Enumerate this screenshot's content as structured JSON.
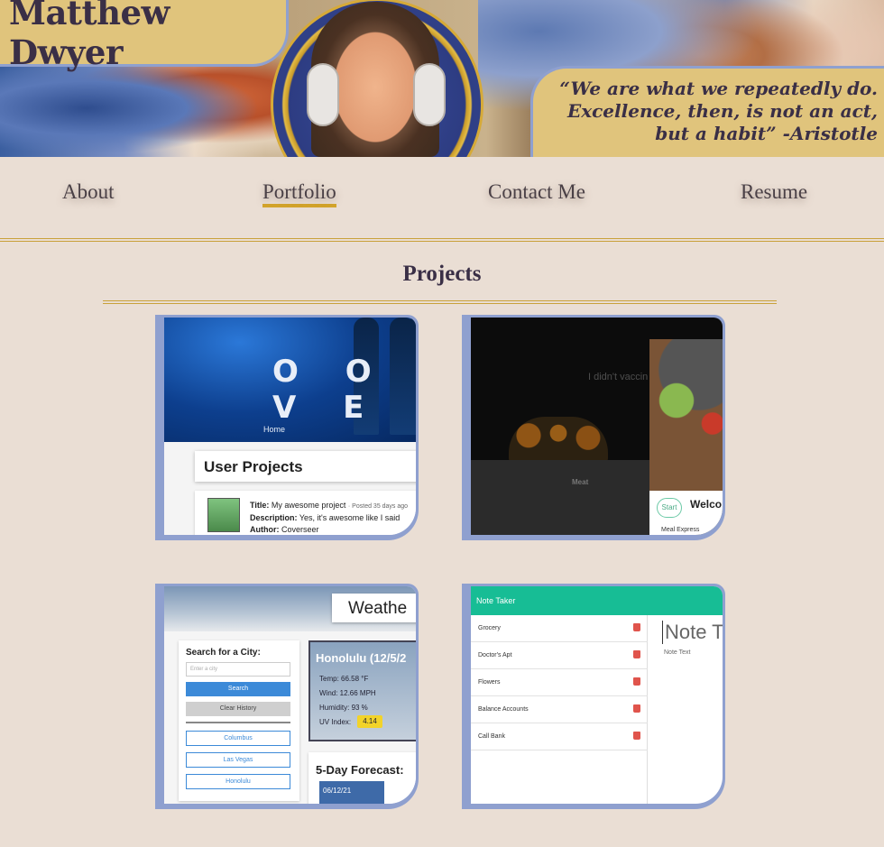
{
  "header": {
    "name": "Matthew Dwyer",
    "quote": "“We are what we repeatedly do. Excellence, then, is not an act, but a habit” -Aristotle"
  },
  "nav": {
    "items": [
      {
        "label": "About",
        "active": false
      },
      {
        "label": "Portfolio",
        "active": true
      },
      {
        "label": "Contact Me",
        "active": false
      },
      {
        "label": "Resume",
        "active": false
      }
    ]
  },
  "projects": {
    "title": "Projects",
    "cards": [
      {
        "banner_logo": "O O V E",
        "banner_nav": "Home",
        "heading": "User Projects",
        "title_label": "Title:",
        "title_value": "My awesome project",
        "posted": "· Posted 35 days ago",
        "desc_label": "Description:",
        "desc_value": "Yes, it's awesome like I said",
        "author_label": "Author:",
        "author_value": "Coverseer"
      },
      {
        "quote": "I didn't vaccin",
        "menu_item": "Meat",
        "start_label": "Start",
        "welcome": "Welco",
        "footer": "Meal Express"
      },
      {
        "title": "Weathe",
        "search_label": "Search for a City:",
        "search_placeholder": "Enter a city",
        "search_button": "Search",
        "clear_button": "Clear History",
        "history": [
          "Columbus",
          "Las Vegas",
          "Honolulu"
        ],
        "current_city": "Honolulu (12/5/2",
        "temp": "Temp: 66.58 °F",
        "wind": "Wind: 12.66 MPH",
        "humidity": "Humidity: 93 %",
        "uv_label": "UV Index:",
        "uv_value": "4.14",
        "forecast_title": "5-Day Forecast:",
        "forecast_date": "06/12/21"
      },
      {
        "app_title": "Note Taker",
        "notes": [
          "Grocery",
          "Doctor's Apt",
          "Flowers",
          "Balance Accounts",
          "Call Bank"
        ],
        "note_title": "Note T",
        "note_text": "Note Text"
      }
    ]
  }
}
